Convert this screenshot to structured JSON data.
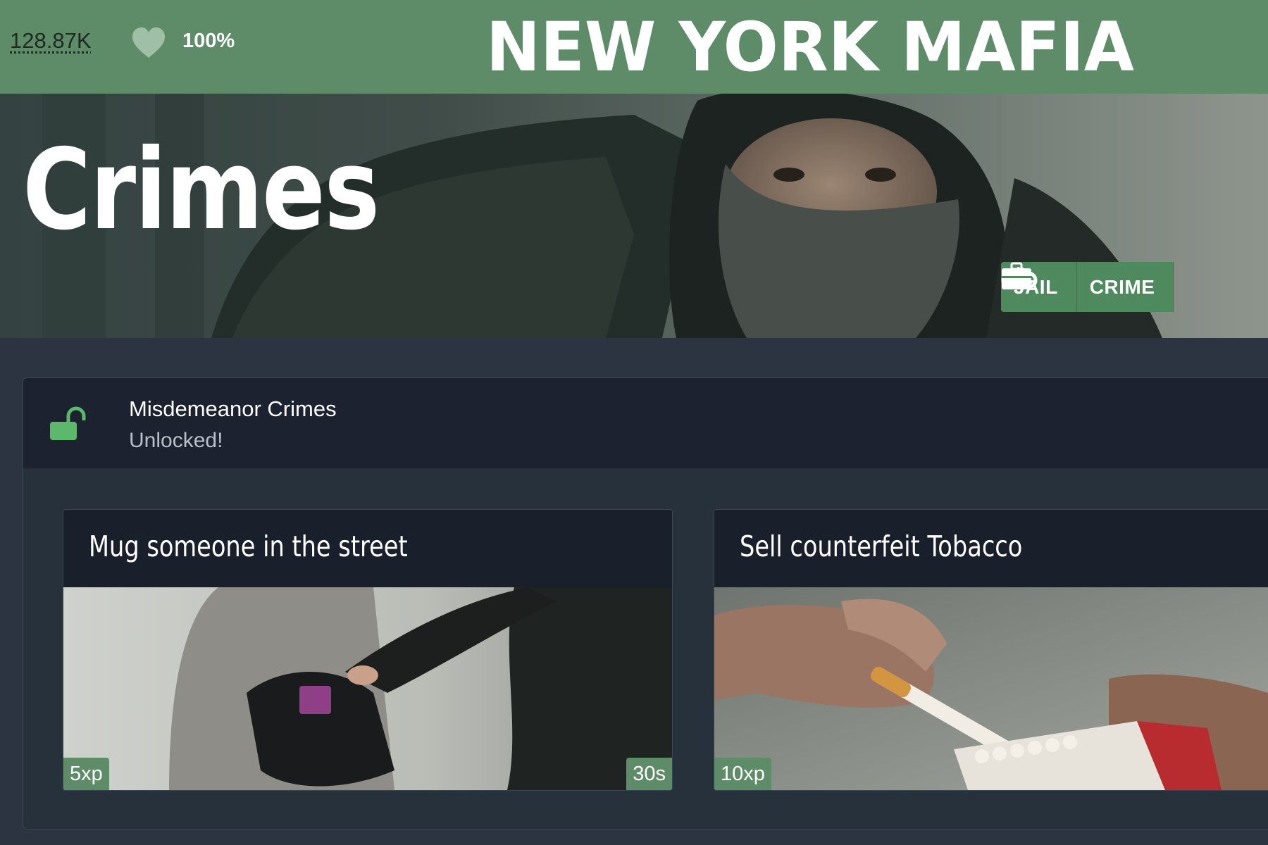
{
  "header": {
    "money": "128.87K",
    "health": "100%",
    "logo": "NEW YORK MAFIA",
    "icons": {
      "health": "heart-icon",
      "logo_emblem": "city-skyline-icon"
    }
  },
  "banner": {
    "title": "Crimes",
    "nav": [
      {
        "label": "JAIL",
        "icon": "handcuffs-icon"
      },
      {
        "label": "CRIME",
        "icon": "briefcase-icon"
      }
    ]
  },
  "category": {
    "title": "Misdemeanor Crimes",
    "status": "Unlocked!",
    "icon": "unlocked-padlock-icon"
  },
  "crimes": [
    {
      "title": "Mug someone in the street",
      "xp": "5xp",
      "time": "30s"
    },
    {
      "title": "Sell counterfeit Tobacco",
      "xp": "10xp",
      "time": ""
    }
  ],
  "colors": {
    "brand_green": "#5e8c69",
    "button_green": "#4f8a5f",
    "panel_dark": "#1d2230",
    "page_bg": "#2b3440",
    "lock_green": "#5cb86a"
  }
}
